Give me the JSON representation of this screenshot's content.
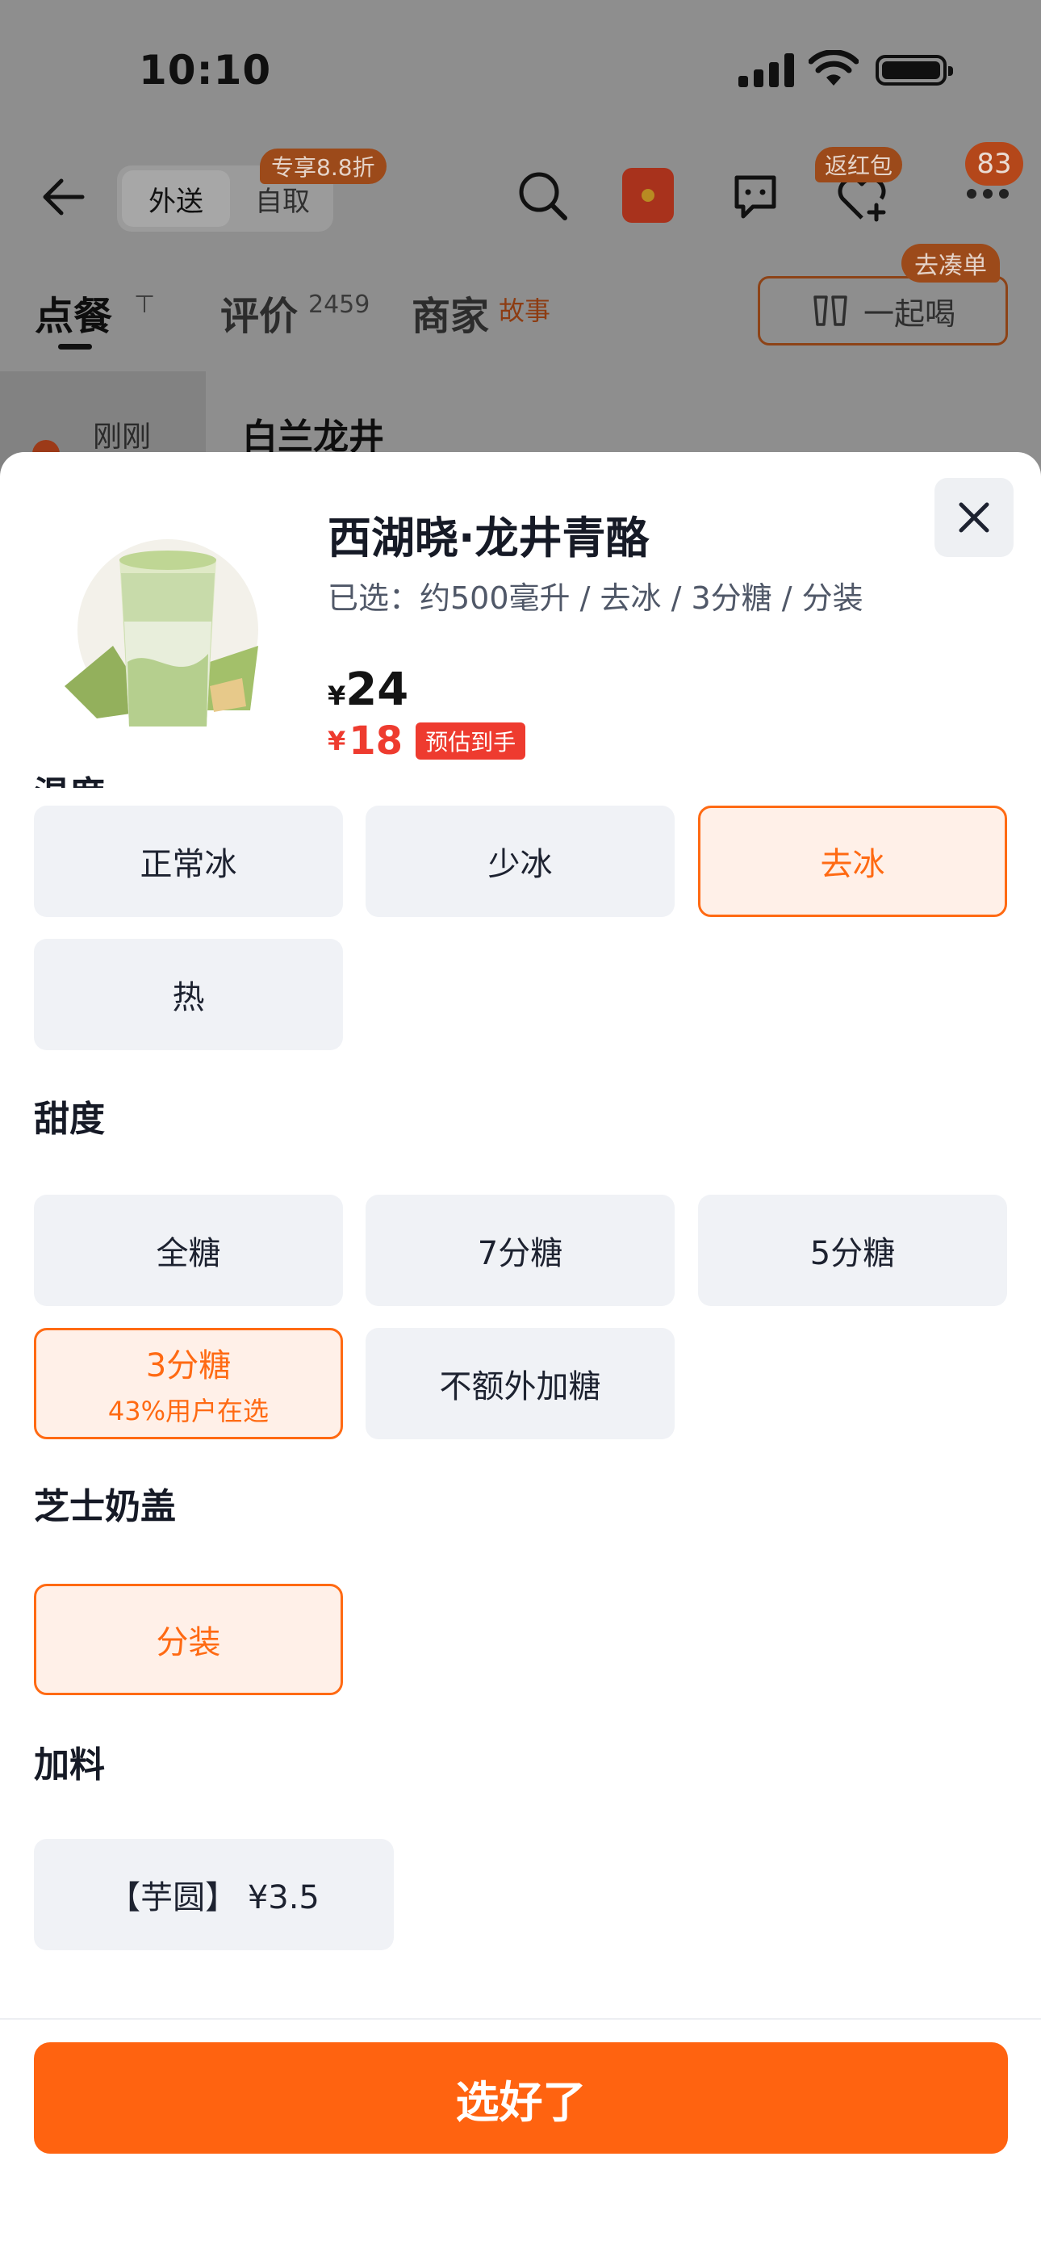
{
  "status_bar": {
    "time": "10:10"
  },
  "header": {
    "mode_active": "外送",
    "mode_other": "自取",
    "promo_badge": "专享8.8折",
    "fav_badge": "返红包",
    "count_badge": "83"
  },
  "tabs": {
    "order": "点餐",
    "order_suffix": "⊤",
    "review": "评价",
    "review_count": "2459",
    "merchant": "商家",
    "merchant_suffix": "故事",
    "drink_label": "一起喝",
    "drink_badge": "去凑单"
  },
  "sidebar": {
    "item": "刚刚"
  },
  "section_peek": "白兰龙井",
  "product": {
    "name": "西湖晓·龙井青酪",
    "selected": "已选：约500毫升 / 去冰 / 3分糖 / 分装",
    "price_currency": "¥",
    "price": "24",
    "price2_currency": "¥",
    "price2": "18",
    "price2_badge": "预估到手"
  },
  "temperature": {
    "title": "温度",
    "options": [
      {
        "label": "正常冰",
        "selected": false
      },
      {
        "label": "少冰",
        "selected": false
      },
      {
        "label": "去冰",
        "selected": true
      },
      {
        "label": "热",
        "selected": false
      }
    ]
  },
  "sweetness": {
    "title": "甜度",
    "options": [
      {
        "label": "全糖",
        "selected": false
      },
      {
        "label": "7分糖",
        "selected": false
      },
      {
        "label": "5分糖",
        "selected": false
      },
      {
        "label": "3分糖",
        "sub": "43%用户在选",
        "selected": true
      },
      {
        "label": "不额外加糖",
        "selected": false
      }
    ]
  },
  "cheese": {
    "title": "芝士奶盖",
    "options": [
      {
        "label": "分装",
        "selected": true
      }
    ]
  },
  "toppings": {
    "title": "加料",
    "options": [
      {
        "label": "【芋圆】 ¥3.5",
        "selected": false
      }
    ]
  },
  "confirm_label": "选好了",
  "colors": {
    "accent": "#ff6310",
    "selected_bg": "#fff0e8",
    "price_red": "#ee3b2f",
    "option_bg": "#f0f2f6"
  }
}
